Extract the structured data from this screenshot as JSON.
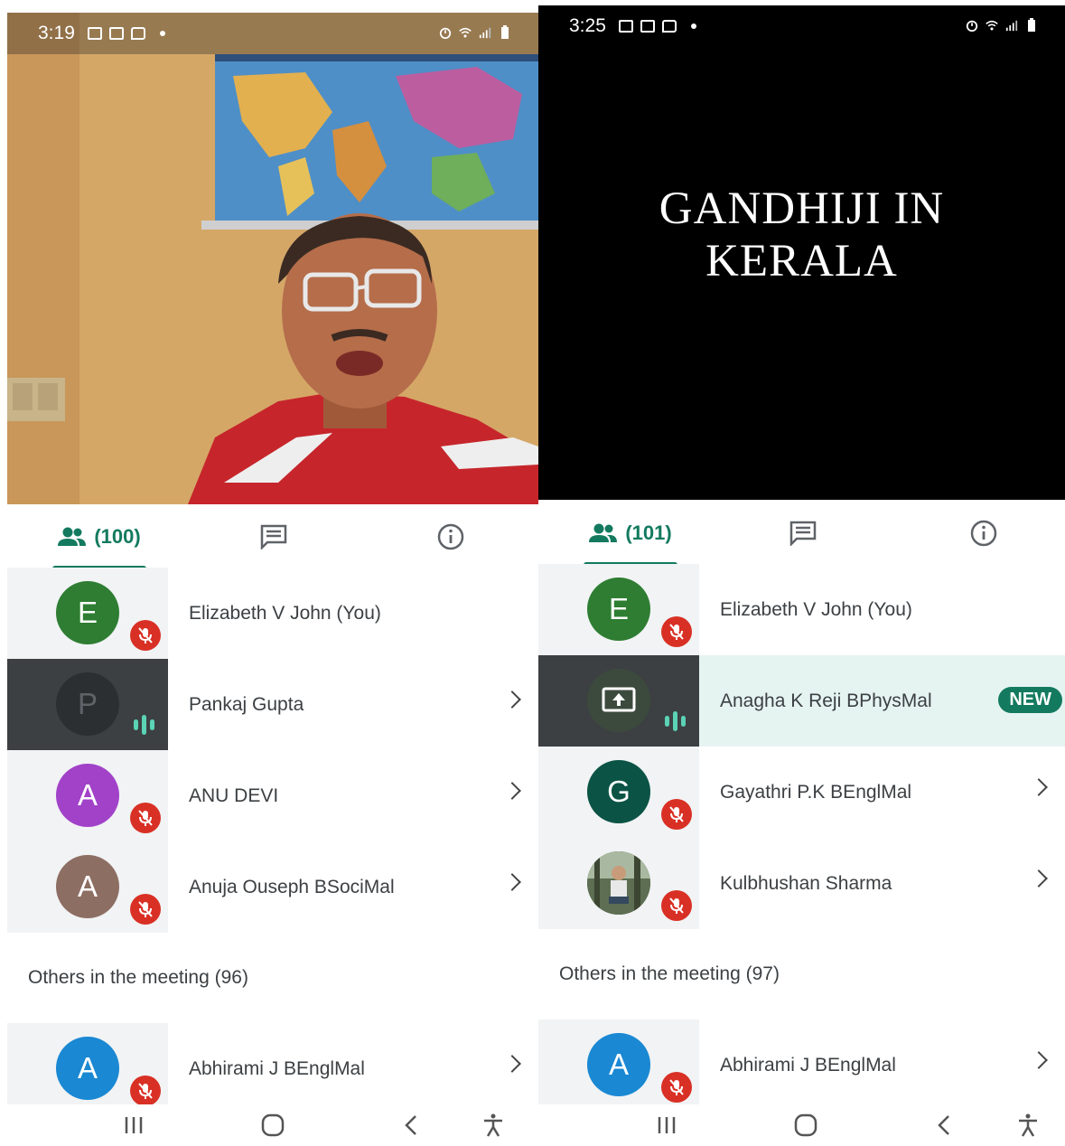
{
  "left": {
    "status_time": "3:19",
    "people_count": "(100)",
    "participants": [
      {
        "initial": "E",
        "name": "Elizabeth V John (You)",
        "color": "#2e7d32",
        "state": "muted",
        "chevron": false
      },
      {
        "initial": "P",
        "name": "Pankaj Gupta",
        "color": "#2b2f31",
        "state": "speaking",
        "chevron": true
      },
      {
        "initial": "A",
        "name": "ANU DEVI",
        "color": "#a142c9",
        "state": "muted",
        "chevron": true
      },
      {
        "initial": "A",
        "name": "Anuja Ouseph BSociMal",
        "color": "#8d6e63",
        "state": "muted",
        "chevron": true
      }
    ],
    "others_header": "Others in the meeting (96)",
    "others": [
      {
        "initial": "A",
        "name": "Abhirami J BEnglMal",
        "color": "#1a88d3",
        "state": "muted",
        "chevron": true
      }
    ]
  },
  "right": {
    "status_time": "3:25",
    "slide_line1": "GANDHIJI IN",
    "slide_line2": "KERALA",
    "people_count": "(101)",
    "participants": [
      {
        "initial": "E",
        "name": "Elizabeth V John (You)",
        "color": "#2e7d32",
        "state": "muted",
        "chevron": false
      },
      {
        "initial": "",
        "icon": "present-screen-icon",
        "name": "Anagha K Reji BPhysMal",
        "color": "#3c4a3e",
        "state": "speaking",
        "badge": "NEW"
      },
      {
        "initial": "G",
        "name": "Gayathri P.K BEnglMal",
        "color": "#0b5345",
        "state": "muted",
        "chevron": true
      },
      {
        "initial": "",
        "photo": true,
        "name": "Kulbhushan Sharma",
        "color": "#6b7b5e",
        "state": "muted",
        "chevron": true
      }
    ],
    "others_header": "Others in the meeting (97)",
    "others": [
      {
        "initial": "A",
        "name": "Abhirami J BEnglMal",
        "color": "#1a88d3",
        "state": "muted",
        "chevron": true
      }
    ]
  },
  "colors": {
    "accent": "#137a5f",
    "mute": "#d93025",
    "speaking": "#5bd3b5"
  }
}
